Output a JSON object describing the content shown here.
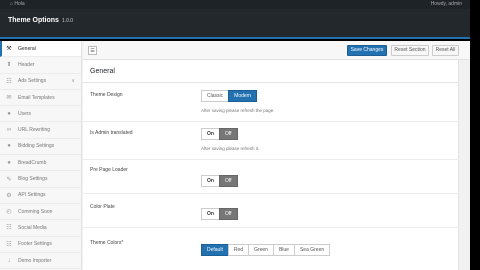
{
  "topbar": {
    "left_text": "⌂  Hola",
    "right_text": "Howdy, admin"
  },
  "header": {
    "title": "Theme Options",
    "version": "1.0.0"
  },
  "sidebar": {
    "items": [
      {
        "label": "General",
        "icon": "wrench-icon",
        "glyph": "⚒",
        "active": true
      },
      {
        "label": "Header",
        "icon": "arrow-up-icon",
        "glyph": "⬆"
      },
      {
        "label": "Ads Settings",
        "icon": "ads-icon",
        "glyph": "☷",
        "chevron": true
      },
      {
        "label": "Email Templates",
        "icon": "email-icon",
        "glyph": "✉"
      },
      {
        "label": "Users",
        "icon": "users-icon",
        "glyph": "●"
      },
      {
        "label": "URL Rewriting",
        "icon": "link-icon",
        "glyph": "∞"
      },
      {
        "label": "Bidding Settings",
        "icon": "bidding-icon",
        "glyph": "●"
      },
      {
        "label": "BreadCrumb",
        "icon": "breadcrumb-icon",
        "glyph": "●"
      },
      {
        "label": "Blog Settings",
        "icon": "blog-icon",
        "glyph": "✎"
      },
      {
        "label": "API Settings",
        "icon": "api-icon",
        "glyph": "⚙"
      },
      {
        "label": "Comming Soon",
        "icon": "clock-icon",
        "glyph": "◴"
      },
      {
        "label": "Social Media",
        "icon": "social-icon",
        "glyph": "☷"
      },
      {
        "label": "Footer Settings",
        "icon": "footer-icon",
        "glyph": "☷"
      },
      {
        "label": "Demo Importer",
        "icon": "importer-icon",
        "glyph": "↓"
      }
    ]
  },
  "toolbar": {
    "menu_glyph": "☰",
    "save_label": "Save Changes",
    "reset_section_label": "Reset Section",
    "reset_all_label": "Reset All"
  },
  "panel": {
    "section_title": "General",
    "theme_design": {
      "label": "Theme Design",
      "options": [
        "Classic",
        "Modern"
      ],
      "selected": "Modern",
      "hint": "After saving please refresh the page."
    },
    "admin_translated": {
      "label": "Is Admin translated",
      "on": "On",
      "off": "Off",
      "hint": "After saving please refresh it."
    },
    "page_loader": {
      "label": "Pre Page Loader",
      "on": "On",
      "off": "Off"
    },
    "color_plate": {
      "label": "Color Plate",
      "on": "On",
      "off": "Off"
    },
    "theme_colors": {
      "label": "Theme Colors*",
      "options": [
        "Default",
        "Red",
        "Green",
        "Blue",
        "Sea Green"
      ],
      "selected": "Default"
    }
  },
  "colors": {
    "accent": "#2271b1",
    "header_bg": "#23282d"
  }
}
